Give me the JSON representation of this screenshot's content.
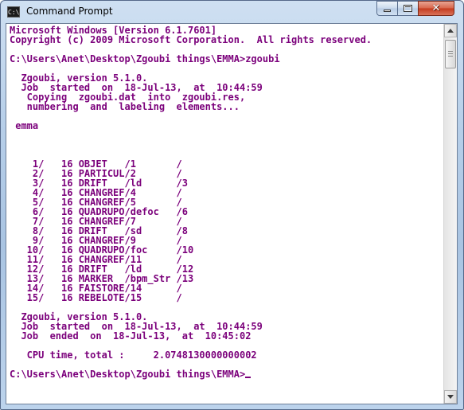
{
  "window": {
    "title": "Command Prompt",
    "icon_label": "C:\\",
    "controls": {
      "minimize_icon": "minimize-icon",
      "maximize_icon": "maximize-icon",
      "close_icon": "close-icon"
    }
  },
  "colors": {
    "console_text": "#7b007b",
    "console_background": "#ffffff",
    "close_button": "#c43a1d"
  },
  "console": {
    "lines": [
      "Microsoft Windows [Version 6.1.7601]",
      "Copyright (c) 2009 Microsoft Corporation.  All rights reserved.",
      "",
      "C:\\Users\\Anet\\Desktop\\Zgoubi things\\EMMA>zgoubi",
      "",
      "  Zgoubi, version 5.1.0.",
      "  Job  started  on  18-Jul-13,  at  10:44:59",
      "   Copying  zgoubi.dat  into  zgoubi.res,",
      "   numbering  and  labeling  elements...",
      "",
      " emma",
      "",
      "",
      "",
      "    1/   16 OBJET   /1       /",
      "    2/   16 PARTICUL/2       /",
      "    3/   16 DRIFT   /ld      /3",
      "    4/   16 CHANGREF/4       /",
      "    5/   16 CHANGREF/5       /",
      "    6/   16 QUADRUPO/defoc   /6",
      "    7/   16 CHANGREF/7       /",
      "    8/   16 DRIFT   /sd      /8",
      "    9/   16 CHANGREF/9       /",
      "   10/   16 QUADRUPO/foc     /10",
      "   11/   16 CHANGREF/11      /",
      "   12/   16 DRIFT   /ld      /12",
      "   13/   16 MARKER  /bpm_Str /13",
      "   14/   16 FAISTORE/14      /",
      "   15/   16 REBELOTE/15      /",
      "",
      "  Zgoubi, version 5.1.0.",
      "  Job  started  on  18-Jul-13,  at  10:44:59",
      "  Job  ended  on  18-Jul-13,  at  10:45:02",
      "",
      "   CPU time, total :     2.0748130000000002",
      "",
      "C:\\Users\\Anet\\Desktop\\Zgoubi things\\EMMA>"
    ]
  },
  "scrollbar": {
    "up_icon": "scroll-up-arrow-icon",
    "down_icon": "scroll-down-arrow-icon",
    "position": 0
  }
}
